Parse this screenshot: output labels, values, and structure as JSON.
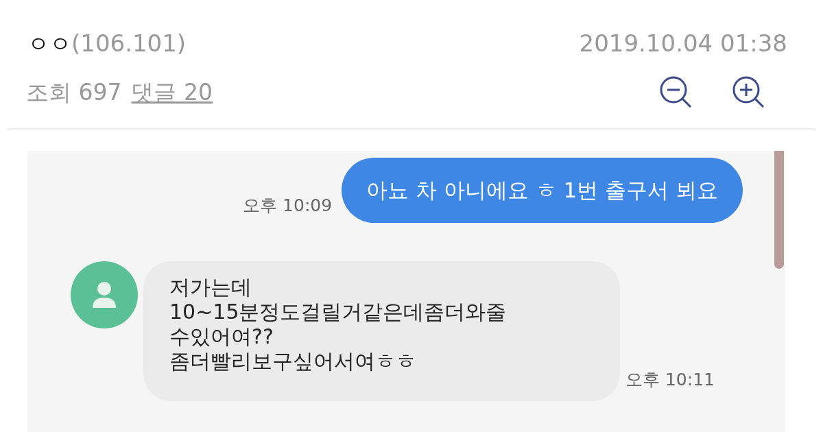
{
  "post": {
    "author": "ㅇㅇ",
    "ip": "(106.101)",
    "date": "2019.10.04 01:38",
    "views": "조회 697",
    "comments": "댓글 20"
  },
  "chat": {
    "messages": [
      {
        "kind": "sent",
        "time": "오후 10:09",
        "lines": [
          "아뇨 차 아니에요 ㅎ 1번 출구서 뵈요"
        ]
      },
      {
        "kind": "received",
        "time": "오후 10:11",
        "lines": [
          "저가는데",
          "10~15분정도걸릴거같은데좀더와줄",
          "수있어여??",
          "좀더빨리보구싶어서여ㅎㅎ"
        ]
      }
    ]
  }
}
